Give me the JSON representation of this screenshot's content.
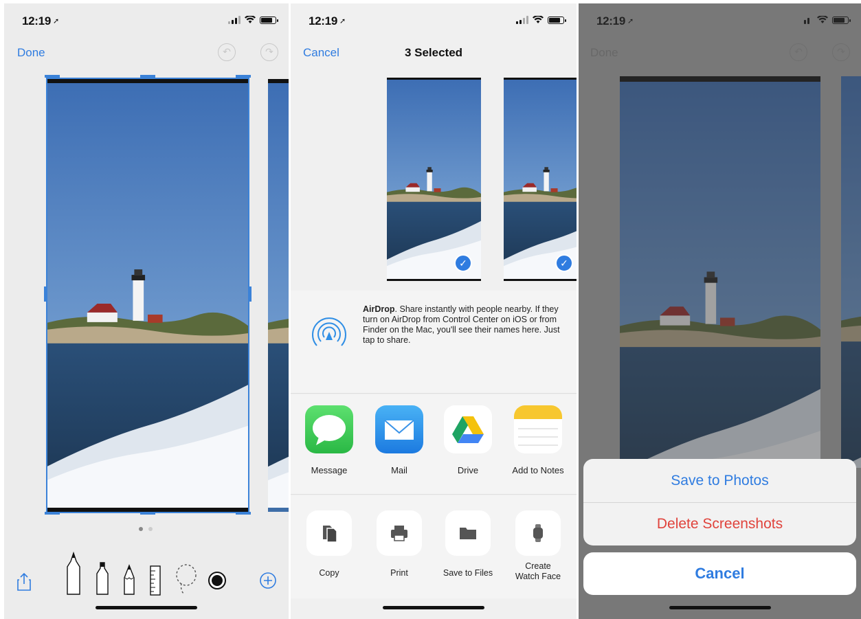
{
  "panel_markup": {
    "status": {
      "time": "12:19"
    },
    "nav": {
      "done": "Done"
    },
    "page_dots": 2,
    "tools": [
      "share-icon",
      "pen-icon",
      "marker-icon",
      "pencil-icon",
      "ruler-icon",
      "lasso-icon",
      "color-picker-icon",
      "add-icon"
    ]
  },
  "panel_share": {
    "status": {
      "time": "12:19"
    },
    "nav": {
      "cancel": "Cancel",
      "title": "3 Selected"
    },
    "airdrop": {
      "title": "AirDrop",
      "text": ". Share instantly with people nearby. If they turn on AirDrop from Control Center on iOS or from Finder on the Mac, you'll see their names here. Just tap to share."
    },
    "apps": [
      {
        "label": "Message",
        "icon": "messages-icon",
        "color": "#34c759"
      },
      {
        "label": "Mail",
        "icon": "mail-icon",
        "color": "#1e88e5"
      },
      {
        "label": "Drive",
        "icon": "google-drive-icon",
        "color": "#ffffff"
      },
      {
        "label": "Add to Notes",
        "icon": "notes-icon",
        "color": "#ffffff"
      }
    ],
    "actions": [
      {
        "label": "Copy",
        "icon": "copy-icon"
      },
      {
        "label": "Print",
        "icon": "print-icon"
      },
      {
        "label": "Save to Files",
        "icon": "folder-icon"
      },
      {
        "label": "Create\nWatch Face",
        "icon": "watch-icon"
      }
    ]
  },
  "panel_save": {
    "status": {
      "time": "12:19"
    },
    "nav": {
      "done": "Done"
    },
    "sheet": {
      "save": "Save to Photos",
      "delete": "Delete Screenshots",
      "cancel": "Cancel"
    },
    "colors": {
      "save": "#2f7ce0",
      "delete": "#e0433c"
    }
  }
}
